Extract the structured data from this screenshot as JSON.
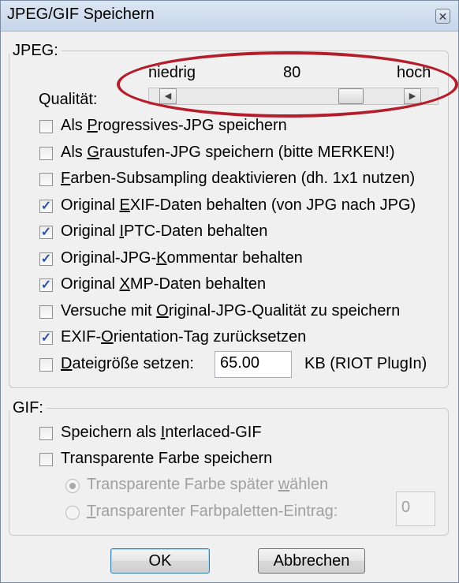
{
  "window": {
    "title": "JPEG/GIF Speichern",
    "close_glyph": "✕"
  },
  "jpeg": {
    "legend": "JPEG:",
    "quality_label": "Qualität:",
    "scale_low": "niedrig",
    "scale_value": "80",
    "scale_high": "hoch",
    "quality_value": 80,
    "options": [
      {
        "pre": "Als ",
        "key": "P",
        "post": "rogressives-JPG speichern",
        "checked": false
      },
      {
        "pre": "Als ",
        "key": "G",
        "post": "raustufen-JPG speichern (bitte MERKEN!)",
        "checked": false
      },
      {
        "pre": "",
        "key": "F",
        "post": "arben-Subsampling deaktivieren (dh. 1x1 nutzen)",
        "checked": false
      },
      {
        "pre": "Original ",
        "key": "E",
        "post": "XIF-Daten behalten (von JPG nach JPG)",
        "checked": true
      },
      {
        "pre": "Original ",
        "key": "I",
        "post": "PTC-Daten behalten",
        "checked": true
      },
      {
        "pre": "Original-JPG-",
        "key": "K",
        "post": "ommentar behalten",
        "checked": true
      },
      {
        "pre": "Original ",
        "key": "X",
        "post": "MP-Daten behalten",
        "checked": true
      },
      {
        "pre": "Versuche mit ",
        "key": "O",
        "post": "riginal-JPG-Qualität zu speichern",
        "checked": false
      },
      {
        "pre": "EXIF-",
        "key": "O",
        "post": "rientation-Tag zurücksetzen",
        "checked": true
      }
    ],
    "filesize": {
      "pre": "",
      "key": "D",
      "post": "ateigröße setzen:",
      "checked": false,
      "value": "65.00",
      "unit": "KB (RIOT PlugIn)"
    }
  },
  "gif": {
    "legend": "GIF:",
    "options": [
      {
        "pre": "Speichern als ",
        "key": "I",
        "post": "nterlaced-GIF",
        "checked": false
      },
      {
        "pre": "Transparente Farbe speichern",
        "key": "",
        "post": "",
        "checked": false
      }
    ],
    "radios": [
      {
        "pre": "Transparente Farbe später ",
        "key": "w",
        "post": "ählen",
        "selected": true
      },
      {
        "pre": "",
        "key": "T",
        "post": "ransparenter Farbpaletten-Eintrag:",
        "selected": false
      }
    ],
    "palette_entry_value": "0"
  },
  "buttons": {
    "ok": "OK",
    "cancel": "Abbrechen"
  },
  "colors": {
    "annotation_oval": "#b51d2b",
    "check_mark": "#2b50a8"
  }
}
